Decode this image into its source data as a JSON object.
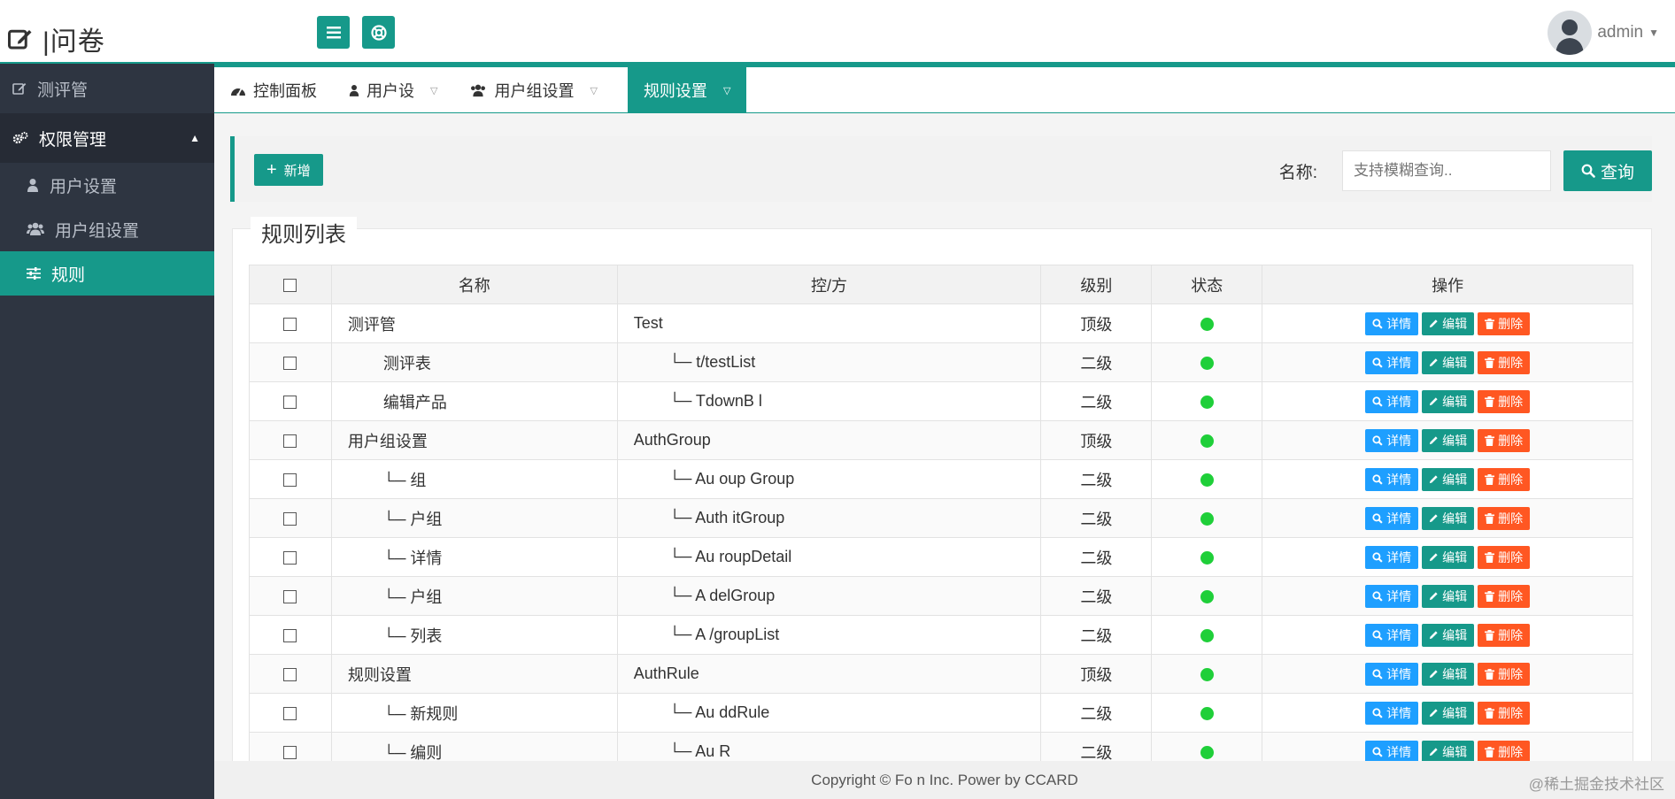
{
  "header": {
    "logo_text": "|问卷",
    "menu_icon": "list-icon",
    "help_icon": "lifebuoy-icon",
    "username": "admin"
  },
  "sidebar": {
    "items": [
      {
        "label": "测评管",
        "icon": "edit-icon"
      },
      {
        "label": "权限管理",
        "icon": "cogs-icon"
      },
      {
        "label": "用户设置",
        "icon": "user-icon"
      },
      {
        "label": "用户组设置",
        "icon": "users-icon"
      },
      {
        "label": "规则",
        "icon": "sliders-icon"
      }
    ]
  },
  "tabs": [
    {
      "label": "控制面板",
      "icon": "dashboard-icon"
    },
    {
      "label": "用户设",
      "icon": "user-icon"
    },
    {
      "label": "用户组设置",
      "icon": "users-icon"
    },
    {
      "label": "规则设置",
      "icon": ""
    }
  ],
  "toolbar": {
    "add_label": "新增",
    "name_label": "名称:",
    "search_placeholder": "支持模糊查询..",
    "query_label": "查询"
  },
  "panel": {
    "title": "规则列表"
  },
  "table": {
    "headers": [
      "",
      "名称",
      "控/方",
      "级别",
      "状态",
      "操作"
    ],
    "rows": [
      {
        "name": "测评管",
        "path": "Test",
        "level": "顶级",
        "child": false
      },
      {
        "name": "测评表",
        "path": "└─ t/testList",
        "level": "二级",
        "child": true
      },
      {
        "name": "编辑产品",
        "path": "└─ TdownB l",
        "level": "二级",
        "child": true
      },
      {
        "name": "用户组设置",
        "path": "AuthGroup",
        "level": "顶级",
        "child": false
      },
      {
        "name": "└─ 组",
        "path": "└─ Au oup Group",
        "level": "二级",
        "child": true
      },
      {
        "name": "└─ 户组",
        "path": "└─ Auth itGroup",
        "level": "二级",
        "child": true
      },
      {
        "name": "└─ 详情",
        "path": "└─ Au roupDetail",
        "level": "二级",
        "child": true
      },
      {
        "name": "└─ 户组",
        "path": "└─ A delGroup",
        "level": "二级",
        "child": true
      },
      {
        "name": "└─ 列表",
        "path": "└─ A /groupList",
        "level": "二级",
        "child": true
      },
      {
        "name": "规则设置",
        "path": "AuthRule",
        "level": "顶级",
        "child": false
      },
      {
        "name": "└─ 新规则",
        "path": "└─ Au ddRule",
        "level": "二级",
        "child": true
      },
      {
        "name": "└─ 编则",
        "path": "└─ Au R",
        "level": "二级",
        "child": true
      }
    ],
    "op_detail": "详情",
    "op_edit": "编辑",
    "op_delete": "删除",
    "status_color": "#1fcf39"
  },
  "footer": {
    "copyright": "Copyright © Fo n Inc. Power by CCARD"
  },
  "watermark": "@稀土掘金技术社区",
  "colors": {
    "accent": "#16998a",
    "sidebar_bg": "#2e3541",
    "detail": "#1e9fff",
    "delete": "#ff5722"
  }
}
